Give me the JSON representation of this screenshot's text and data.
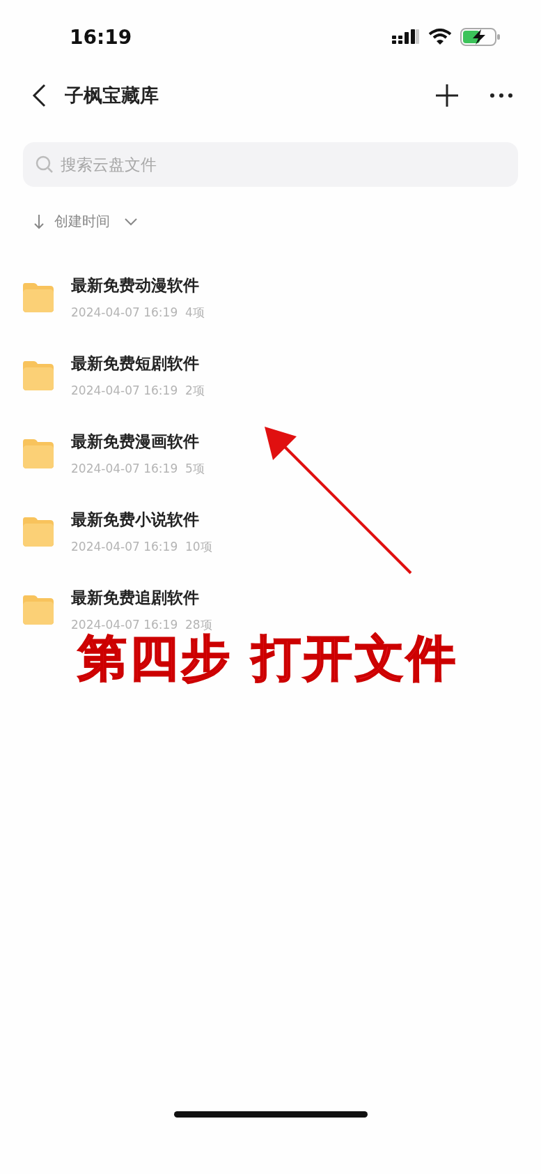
{
  "status_bar": {
    "time": "16:19"
  },
  "header": {
    "title": "子枫宝藏库"
  },
  "search": {
    "placeholder": "搜索云盘文件"
  },
  "sort": {
    "label": "创建时间"
  },
  "files": [
    {
      "name": "最新免费动漫软件",
      "date": "2024-04-07 16:19",
      "count": "4项"
    },
    {
      "name": "最新免费短剧软件",
      "date": "2024-04-07 16:19",
      "count": "2项"
    },
    {
      "name": "最新免费漫画软件",
      "date": "2024-04-07 16:19",
      "count": "5项"
    },
    {
      "name": "最新免费小说软件",
      "date": "2024-04-07 16:19",
      "count": "10项"
    },
    {
      "name": "最新免费追剧软件",
      "date": "2024-04-07 16:19",
      "count": "28项"
    }
  ],
  "annotation": {
    "caption": "第四步 打开文件"
  }
}
